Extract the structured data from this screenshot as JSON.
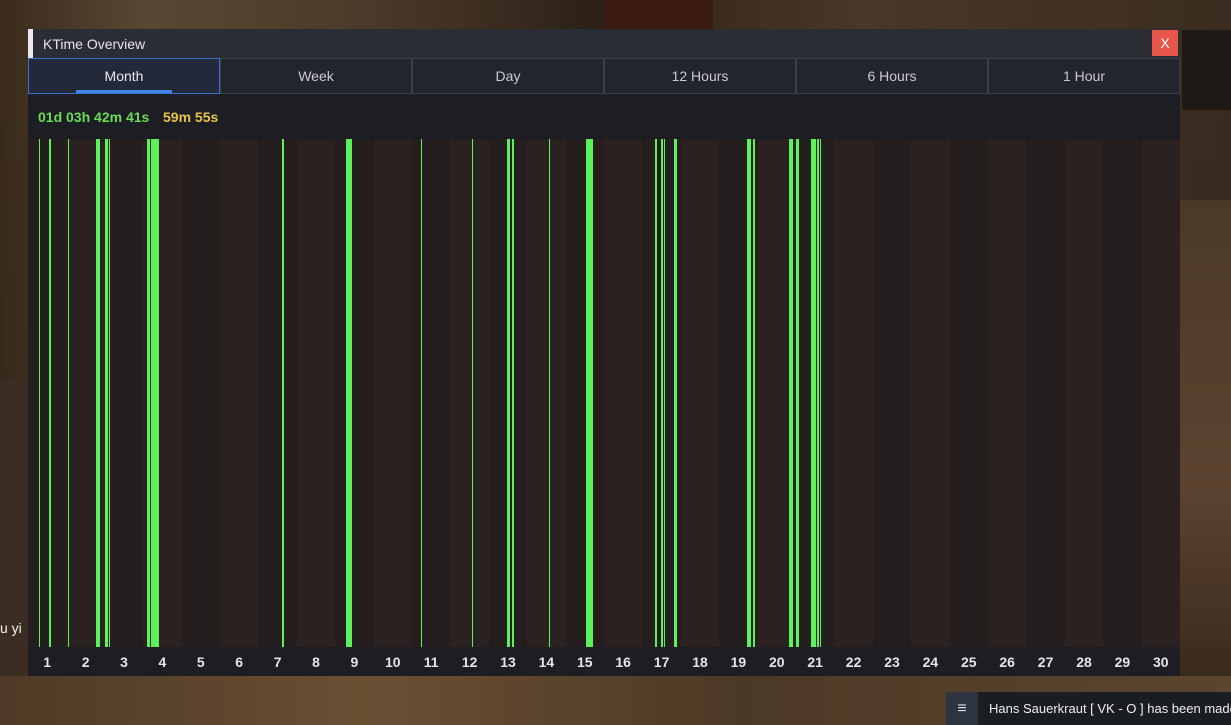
{
  "window": {
    "title": "KTime Overview",
    "close_label": "X"
  },
  "tabs": [
    {
      "label": "Month",
      "active": true
    },
    {
      "label": "Week",
      "active": false
    },
    {
      "label": "Day",
      "active": false
    },
    {
      "label": "12 Hours",
      "active": false
    },
    {
      "label": "6 Hours",
      "active": false
    },
    {
      "label": "1 Hour",
      "active": false
    }
  ],
  "stats": {
    "total_time": "01d 03h 42m 41s",
    "session_time": "59m 55s"
  },
  "chart_data": {
    "type": "bar",
    "categories": [
      "1",
      "2",
      "3",
      "4",
      "5",
      "6",
      "7",
      "8",
      "9",
      "10",
      "11",
      "12",
      "13",
      "14",
      "15",
      "16",
      "17",
      "18",
      "19",
      "20",
      "21",
      "22",
      "23",
      "24",
      "25",
      "26",
      "27",
      "28",
      "29",
      "30"
    ],
    "activity": [
      {
        "day": 1,
        "spans": [
          [
            0.28,
            0.32
          ],
          [
            0.55,
            0.6
          ]
        ]
      },
      {
        "day": 2,
        "spans": [
          [
            0.04,
            0.08
          ],
          [
            0.77,
            0.87
          ]
        ]
      },
      {
        "day": 3,
        "spans": [
          [
            0.0,
            0.04
          ],
          [
            0.03,
            0.08
          ],
          [
            0.1,
            0.14
          ]
        ]
      },
      {
        "day": 4,
        "spans": [
          [
            0.1,
            0.14
          ],
          [
            0.15,
            0.18
          ],
          [
            0.2,
            0.42
          ]
        ]
      },
      {
        "day": 7,
        "spans": [
          [
            0.62,
            0.66
          ]
        ]
      },
      {
        "day": 9,
        "spans": [
          [
            0.29,
            0.43
          ]
        ]
      },
      {
        "day": 11,
        "spans": [
          [
            0.23,
            0.27
          ]
        ]
      },
      {
        "day": 12,
        "spans": [
          [
            0.56,
            0.6
          ]
        ]
      },
      {
        "day": 13,
        "spans": [
          [
            0.48,
            0.56
          ],
          [
            0.6,
            0.65
          ]
        ]
      },
      {
        "day": 14,
        "spans": [
          [
            0.56,
            0.6
          ]
        ]
      },
      {
        "day": 15,
        "spans": [
          [
            0.53,
            0.72
          ]
        ]
      },
      {
        "day": 17,
        "spans": [
          [
            0.32,
            0.37
          ],
          [
            0.48,
            0.53
          ],
          [
            0.56,
            0.6
          ],
          [
            0.83,
            0.9
          ]
        ]
      },
      {
        "day": 19,
        "spans": [
          [
            0.72,
            0.84
          ],
          [
            0.88,
            0.92
          ]
        ]
      },
      {
        "day": 20,
        "spans": [
          [
            0.83,
            0.92
          ]
        ]
      },
      {
        "day": 21,
        "spans": [
          [
            0.0,
            0.08
          ],
          [
            0.4,
            0.52
          ],
          [
            0.55,
            0.59
          ],
          [
            0.62,
            0.66
          ]
        ]
      }
    ]
  },
  "side_text": "u yi",
  "notification": {
    "icon": "notification-icon",
    "text": "Hans Sauerkraut [ VK - O ] has been made"
  },
  "colors": {
    "bar": "#5cf25c",
    "col_a": "#251e1e",
    "col_b": "#2b2121",
    "accent": "#3f86ea",
    "close": "#e8554a",
    "total": "#6ddb58",
    "session": "#e9c14a"
  }
}
